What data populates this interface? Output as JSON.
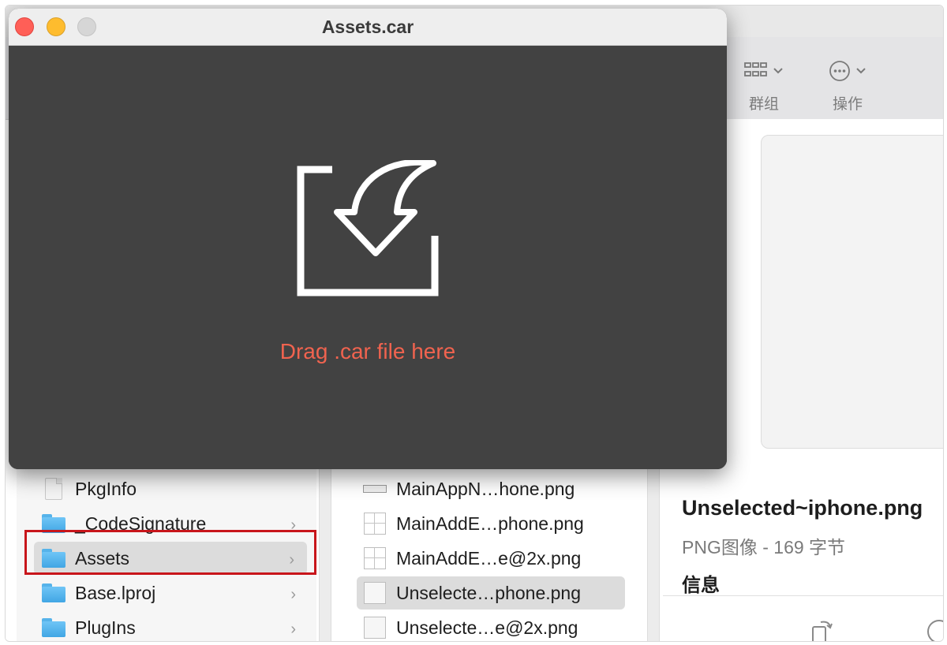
{
  "app_window": {
    "title": "Assets.car",
    "drop_prompt": "Drag .car file here"
  },
  "finder": {
    "toolbar": {
      "group_label": "群组",
      "action_label": "操作"
    },
    "column1": [
      {
        "name": "PkgInfo",
        "kind": "file",
        "has_children": false
      },
      {
        "name": "_CodeSignature",
        "kind": "folder",
        "has_children": true
      },
      {
        "name": "Assets",
        "kind": "folder",
        "has_children": true,
        "selected": true
      },
      {
        "name": "Base.lproj",
        "kind": "folder",
        "has_children": true
      },
      {
        "name": "PlugIns",
        "kind": "folder",
        "has_children": true
      }
    ],
    "column2": [
      {
        "name": "MainAppN…hone.png",
        "icon": "png-wide-icon"
      },
      {
        "name": "MainAddE…phone.png",
        "icon": "png-grid-icon"
      },
      {
        "name": "MainAddE…e@2x.png",
        "icon": "png-grid-icon"
      },
      {
        "name": "Unselecte…phone.png",
        "icon": "png-blank-icon",
        "selected": true
      },
      {
        "name": "Unselecte…e@2x.png",
        "icon": "png-blank-icon"
      }
    ],
    "preview": {
      "title": "Unselected~iphone.png",
      "subtitle": "PNG图像 - 169 字节",
      "info_heading": "信息"
    }
  },
  "colors": {
    "accent_drop_text": "#f0634f",
    "app_background": "#424242",
    "highlight_box": "#c8151b",
    "folder_blue": "#4aaeea"
  }
}
